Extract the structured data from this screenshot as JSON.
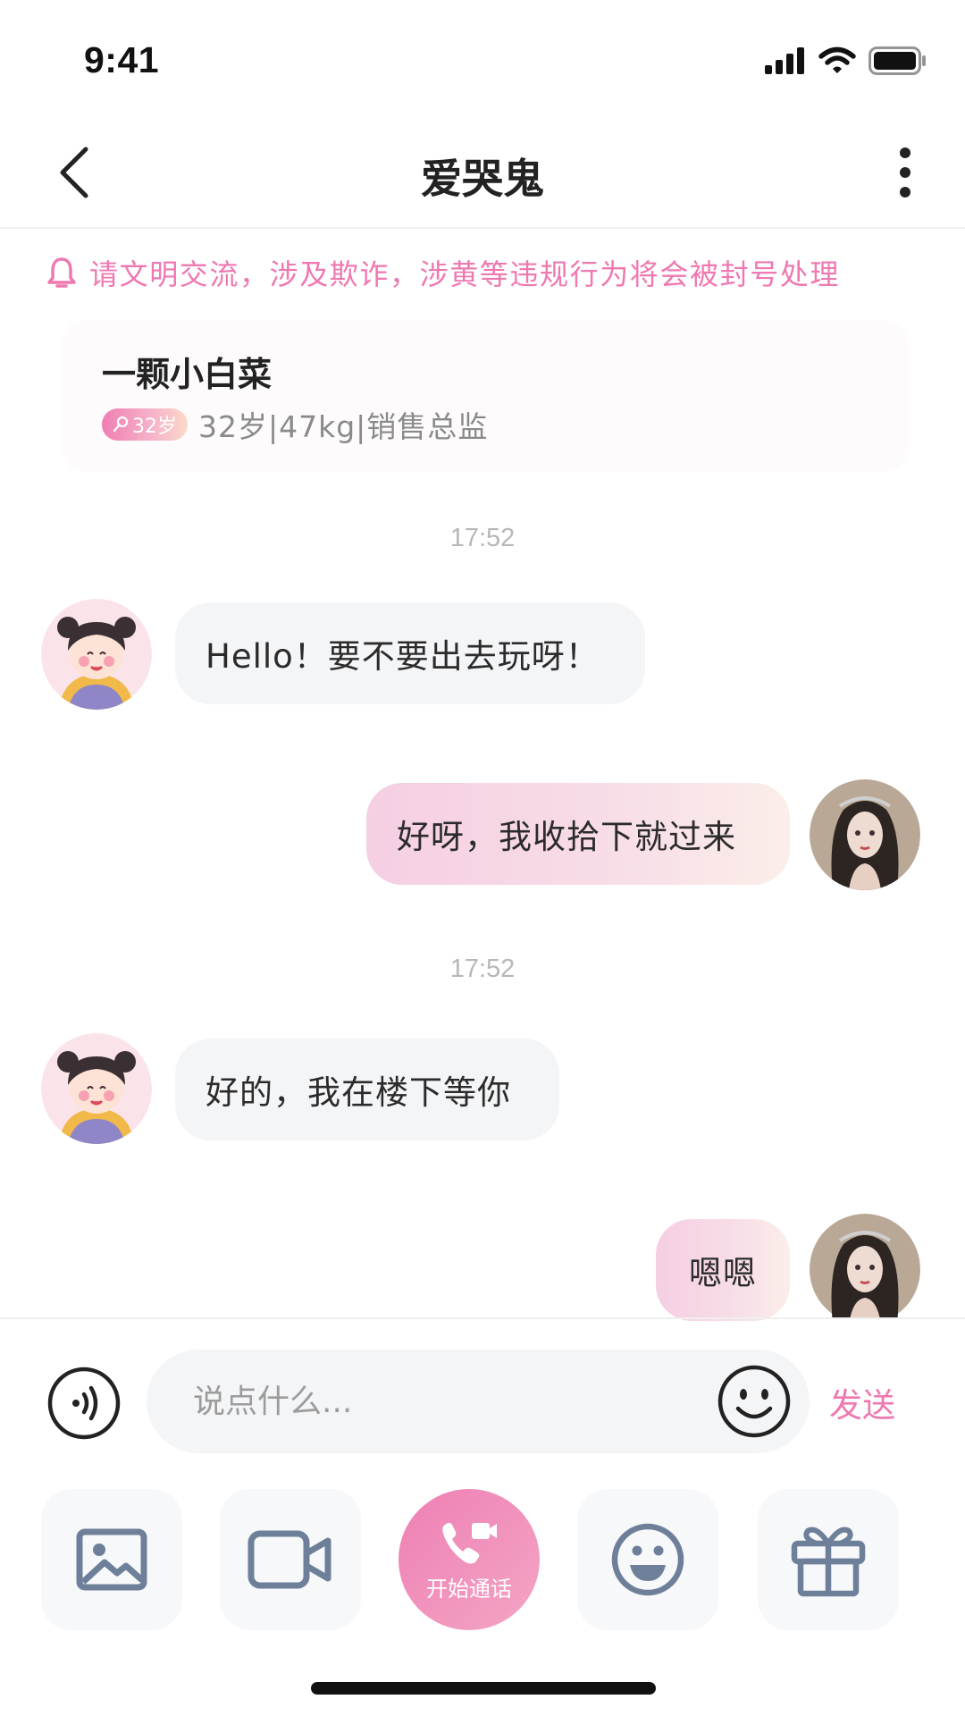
{
  "status_bar": {
    "time": "9:41"
  },
  "nav": {
    "title": "爱哭鬼"
  },
  "notice": {
    "text": "请文明交流，涉及欺诈，涉黄等违规行为将会被封号处理"
  },
  "profile": {
    "name": "一颗小白菜",
    "age_badge": "32岁",
    "info": "32岁|47kg|销售总监"
  },
  "messages": [
    {
      "timestamp": "17:52"
    },
    {
      "direction": "incoming",
      "text": "Hello！要不要出去玩呀！"
    },
    {
      "direction": "outgoing",
      "text": "好呀，我收拾下就过来"
    },
    {
      "timestamp": "17:52"
    },
    {
      "direction": "incoming",
      "text": "好的，我在楼下等你"
    },
    {
      "direction": "outgoing",
      "text": "嗯嗯"
    }
  ],
  "input": {
    "placeholder": "说点什么...",
    "send_label": "发送"
  },
  "toolbar": {
    "items": [
      {
        "icon": "image-icon"
      },
      {
        "icon": "video-camera-icon"
      },
      {
        "icon": "phone-call-icon",
        "label": "开始通话"
      },
      {
        "icon": "smile-icon"
      },
      {
        "icon": "gift-icon"
      }
    ]
  },
  "colors": {
    "accent": "#ef78b1",
    "tool_icon": "#6e7f99",
    "bubble_incoming": "#f4f5f7"
  }
}
